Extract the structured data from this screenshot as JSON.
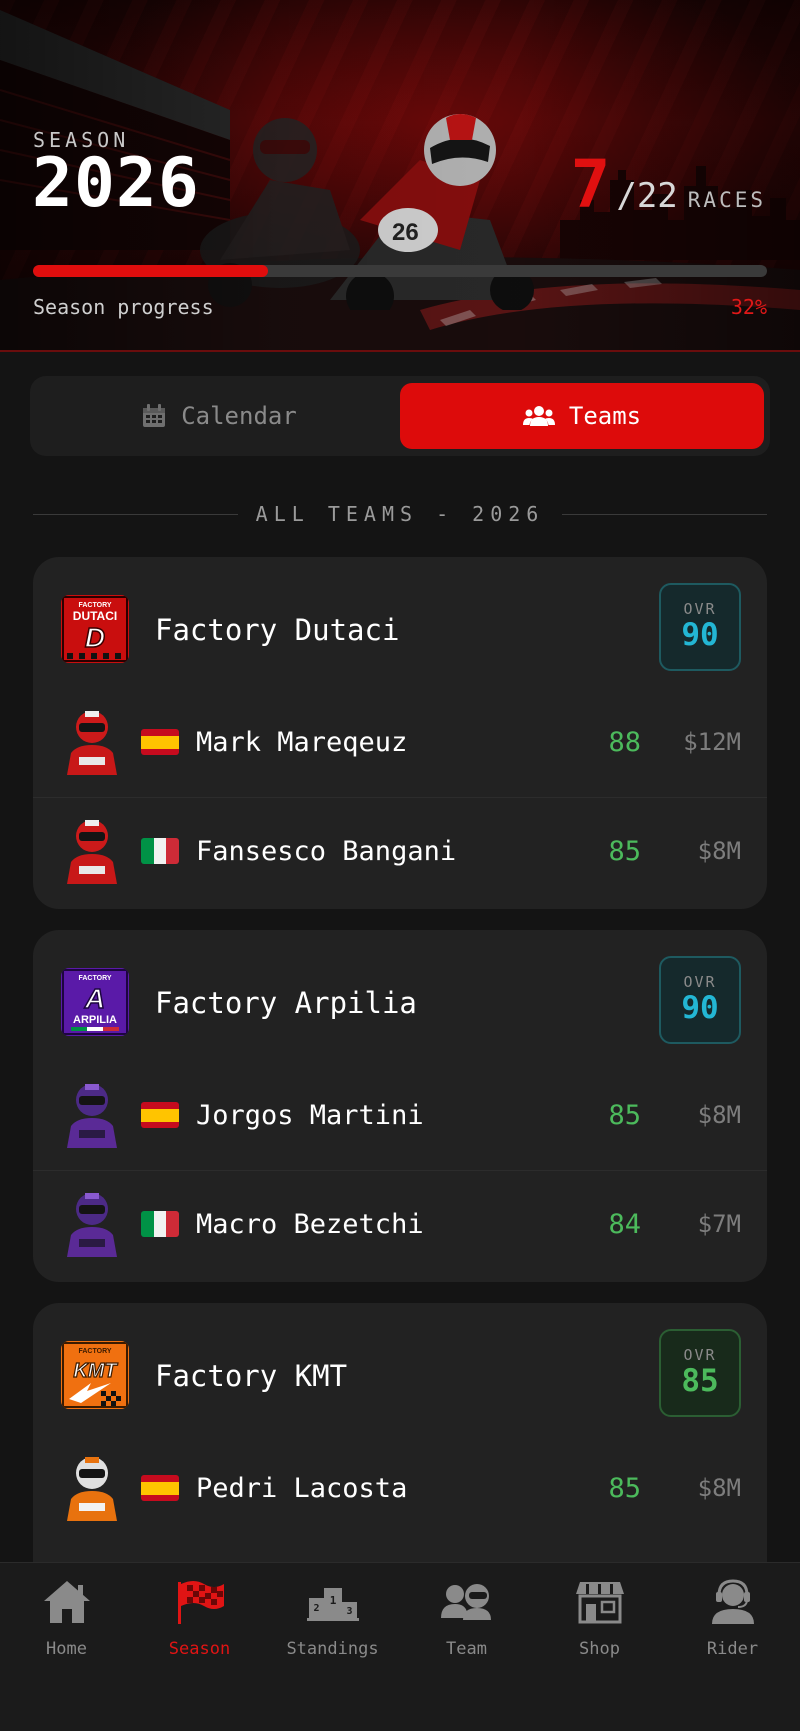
{
  "hero": {
    "season_label": "SEASON",
    "year": "2026",
    "race_current": "7",
    "race_total": "/22",
    "race_unit": "RACES",
    "progress_label": "Season progress",
    "progress_pct_text": "32%",
    "progress_fraction": 0.32
  },
  "toggle": {
    "calendar_label": "Calendar",
    "teams_label": "Teams",
    "active": "teams"
  },
  "section_title": "ALL TEAMS - 2026",
  "teams": [
    {
      "name": "Factory Dutaci",
      "ovr_label": "OVR",
      "ovr": "90",
      "ovr_color": "#23b6d4",
      "logo_text": [
        "FACTORY",
        "DUTACI",
        "D"
      ],
      "riders": [
        {
          "flag": "es",
          "name": "Mark Mareqeuz",
          "rating": "88",
          "salary": "$12M"
        },
        {
          "flag": "it",
          "name": "Fansesco Bangani",
          "rating": "85",
          "salary": "$8M"
        }
      ]
    },
    {
      "name": "Factory Arpilia",
      "ovr_label": "OVR",
      "ovr": "90",
      "ovr_color": "#23b6d4",
      "logo_text": [
        "FACTORY",
        "A",
        "ARPILIA"
      ],
      "riders": [
        {
          "flag": "es",
          "name": "Jorgos Martini",
          "rating": "85",
          "salary": "$8M"
        },
        {
          "flag": "it",
          "name": "Macro Bezetchi",
          "rating": "84",
          "salary": "$7M"
        }
      ]
    },
    {
      "name": "Factory KMT",
      "ovr_label": "OVR",
      "ovr": "85",
      "ovr_color": "#4cba5c",
      "logo_text": [
        "FACTORY",
        "KMT"
      ],
      "riders": [
        {
          "flag": "es",
          "name": "Pedri Lacosta",
          "rating": "85",
          "salary": "$8M"
        }
      ]
    }
  ],
  "nav": [
    {
      "label": "Home",
      "icon": "home-icon"
    },
    {
      "label": "Season",
      "icon": "checkered-flag-icon",
      "active": true
    },
    {
      "label": "Standings",
      "icon": "podium-icon"
    },
    {
      "label": "Team",
      "icon": "team-helmets-icon"
    },
    {
      "label": "Shop",
      "icon": "shop-icon"
    },
    {
      "label": "Rider",
      "icon": "rider-headset-icon"
    }
  ],
  "colors": {
    "accent": "#dd0b0b",
    "rating_green": "#4cba5c",
    "ovr_cyan": "#23b6d4",
    "background": "#141414",
    "card": "#222222"
  }
}
